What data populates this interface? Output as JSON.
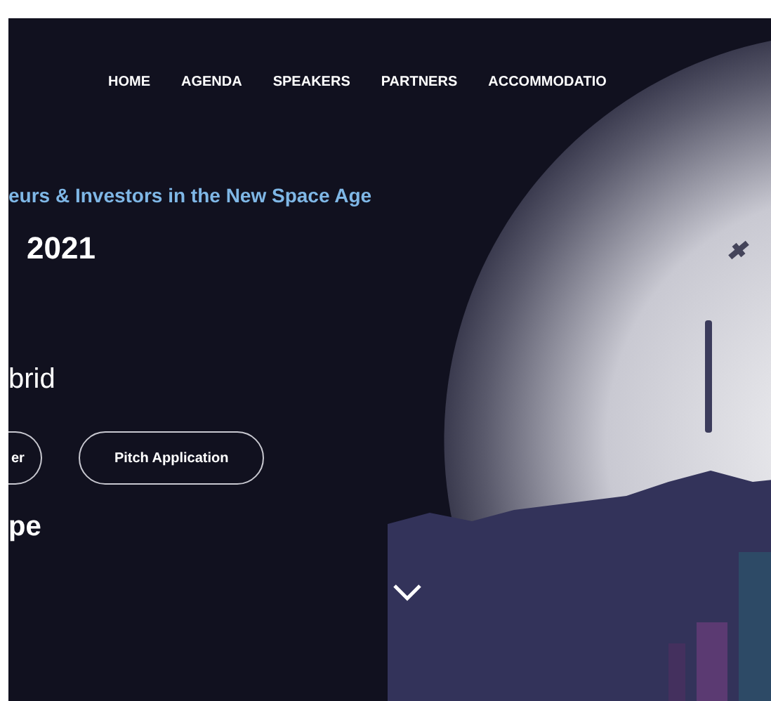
{
  "nav": {
    "items": [
      {
        "label": "HOME"
      },
      {
        "label": "AGENDA"
      },
      {
        "label": "SPEAKERS"
      },
      {
        "label": "PARTNERS"
      },
      {
        "label": "ACCOMMODATIO"
      }
    ]
  },
  "hero": {
    "tagline": "eurs & Investors in the New Space Age",
    "year": "2021",
    "format": "brid",
    "buttons": [
      {
        "label": "er"
      },
      {
        "label": "Pitch Application"
      }
    ],
    "location": "pe"
  }
}
